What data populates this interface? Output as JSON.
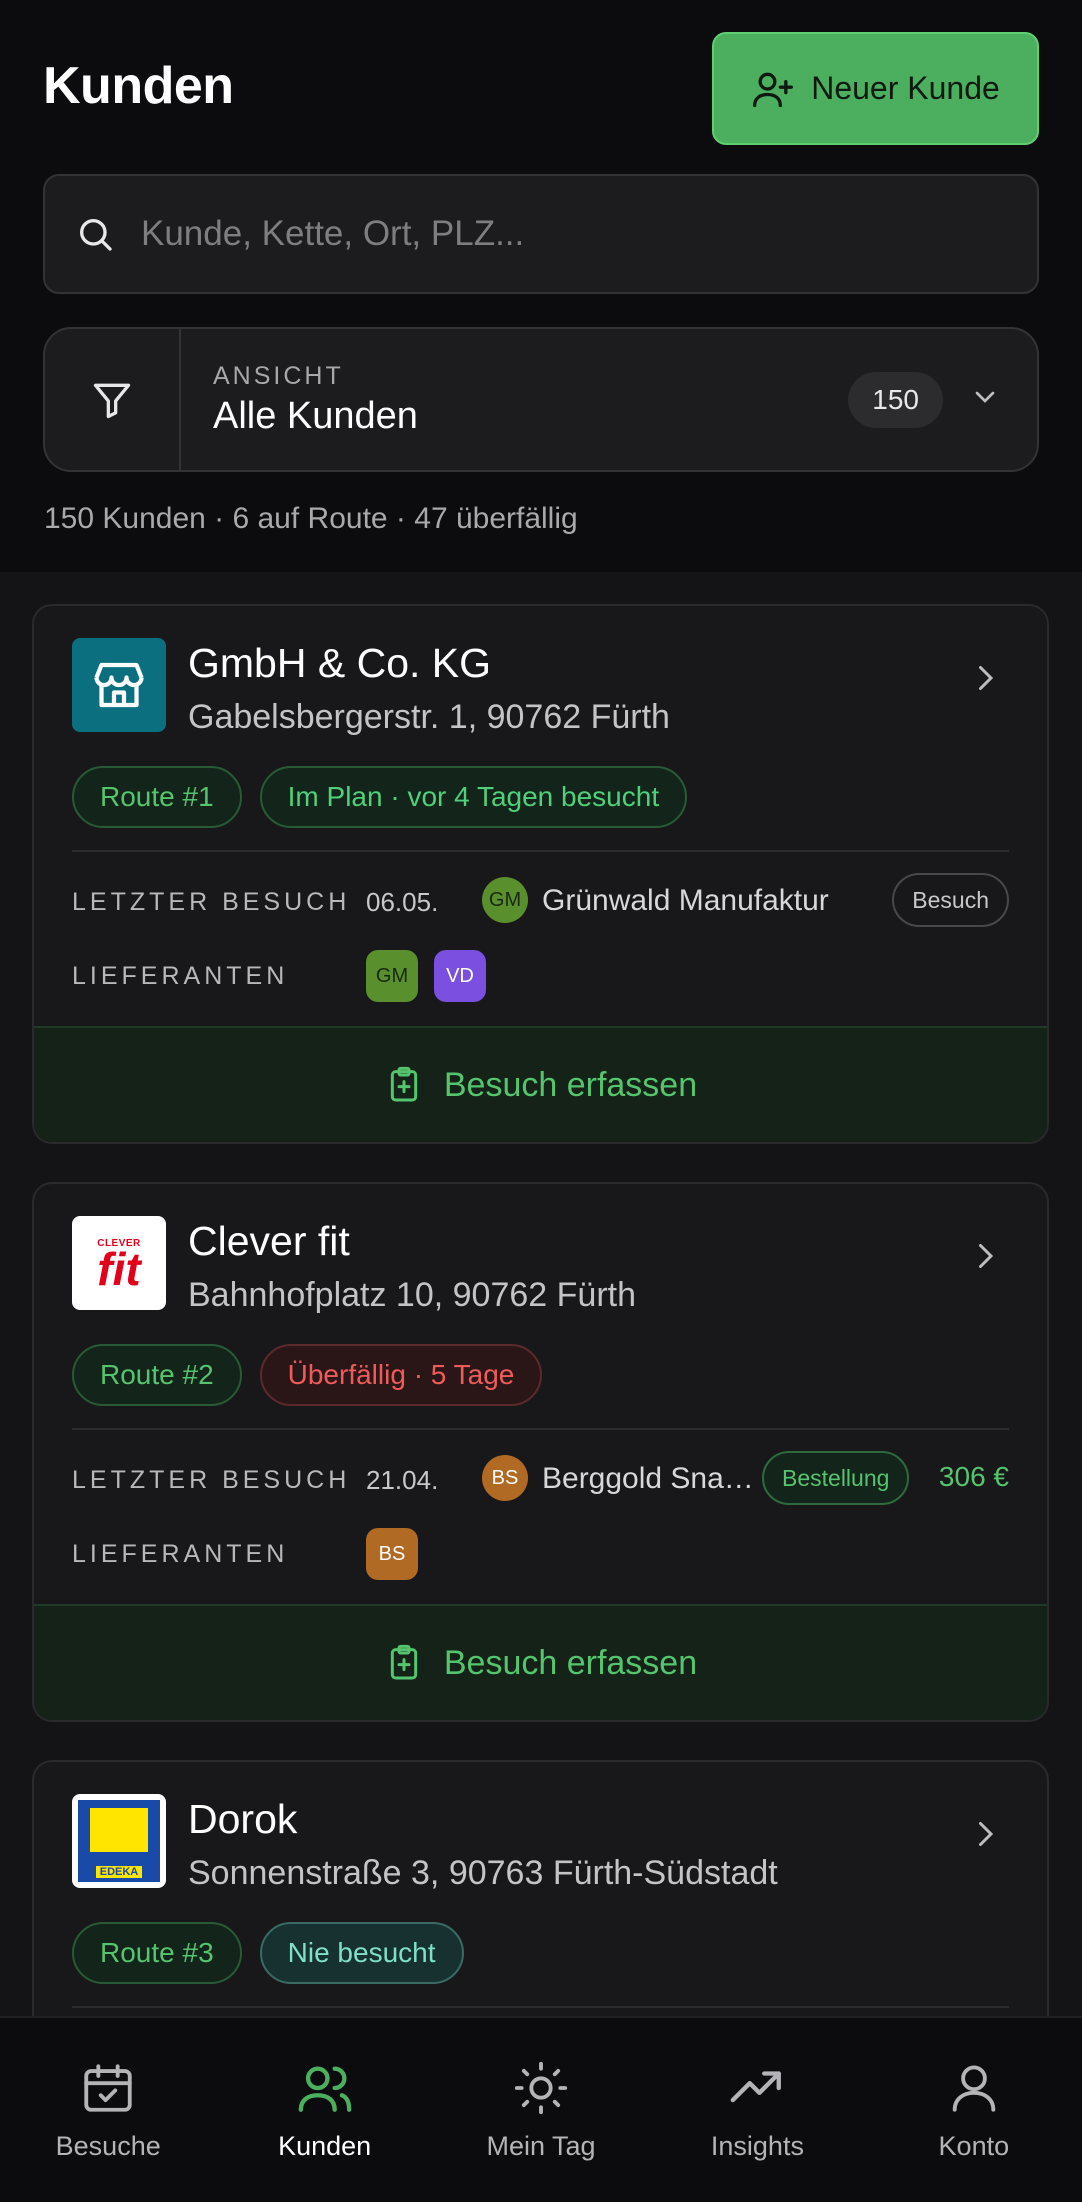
{
  "header": {
    "title": "Kunden",
    "new_customer_label": "Neuer Kunde"
  },
  "search": {
    "placeholder": "Kunde, Kette, Ort, PLZ..."
  },
  "filter": {
    "label": "ANSICHT",
    "value": "Alle Kunden",
    "count": "150"
  },
  "summary": "150 Kunden · 6 auf Route · 47 überfällig",
  "labels": {
    "last_visit": "LETZTER BESUCH",
    "suppliers": "LIEFERANTEN",
    "record_visit": "Besuch erfassen"
  },
  "customers": [
    {
      "name": "GmbH & Co. KG",
      "address": "Gabelsbergerstr. 1, 90762 Fürth",
      "route": "Route #1",
      "status": "Im Plan · vor 4 Tagen besucht",
      "last_visit_date": "06.05.",
      "last_visit_supplier_initials": "GM",
      "last_visit_supplier": "Grünwald Manufaktur",
      "last_visit_type": "Besuch",
      "suppliers": [
        "GM",
        "VD"
      ]
    },
    {
      "name": "Clever fit",
      "logo_text_top": "CLEVER",
      "logo_text_main": "fit",
      "address": "Bahnhofplatz 10, 90762 Fürth",
      "route": "Route #2",
      "status": "Überfällig · 5 Tage",
      "last_visit_date": "21.04.",
      "last_visit_supplier_initials": "BS",
      "last_visit_supplier": "Berggold Sna…",
      "last_visit_type": "Bestellung",
      "last_visit_amount": "306 €",
      "suppliers": [
        "BS"
      ]
    },
    {
      "name": "Dorok",
      "logo_text": "EDEKA",
      "address": "Sonnenstraße 3, 90763 Fürth-Südstadt",
      "route": "Route #3",
      "status": "Nie besucht"
    }
  ],
  "nav": {
    "items": [
      "Besuche",
      "Kunden",
      "Mein Tag",
      "Insights",
      "Konto"
    ],
    "active": "Kunden"
  },
  "colors": {
    "accent": "#4caf5f",
    "overdue": "#ef5b5b",
    "never_visited": "#7fe0c8",
    "avatar_gm": "#5a8f2e",
    "avatar_vd": "#7b4fe0",
    "avatar_bs": "#b06a24"
  }
}
